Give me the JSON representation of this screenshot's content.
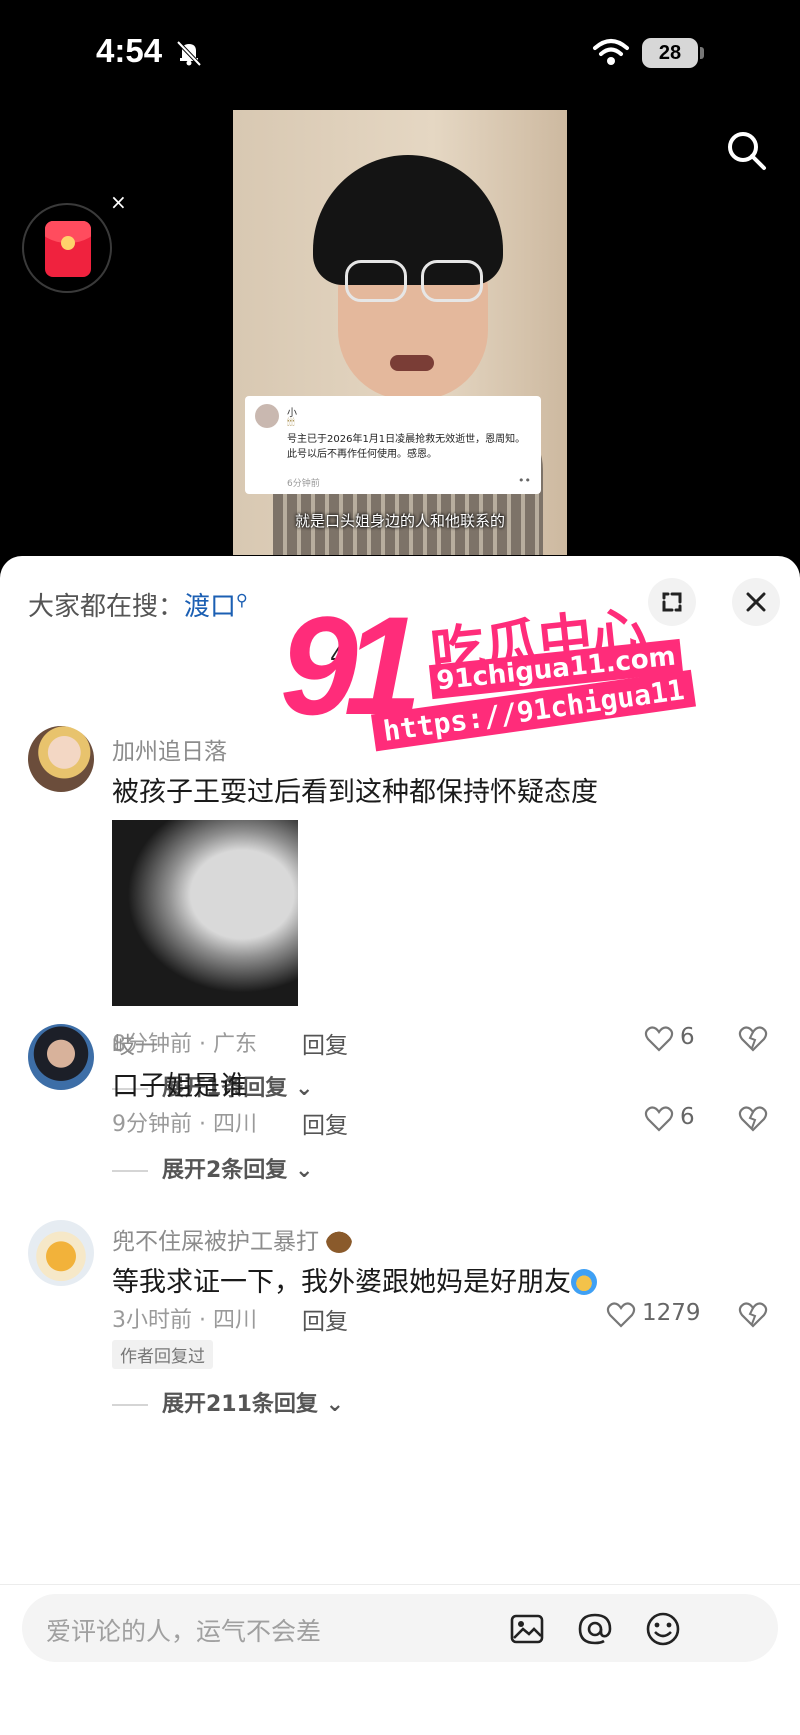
{
  "status_bar": {
    "time": "4:54",
    "battery": "28"
  },
  "video": {
    "card": {
      "name": "小",
      "candles": "🕯🕯🕯",
      "text": "号主已于2026年1月1日凌晨抢救无效逝世，恩周知。此号以后不再作任何使用。感恩。",
      "time": "6分钟前",
      "more": "••"
    },
    "subtitle": "就是口头姐身边的人和他联系的"
  },
  "redpacket_close": "×",
  "sheet": {
    "hot_search_prefix": "大家都在搜：",
    "hot_search_keyword": "渡口",
    "comment_count": "4"
  },
  "watermark": {
    "number": "91",
    "title": "吃瓜中心",
    "domain": "91chigua11.com",
    "url": "https://91chigua11"
  },
  "comments": [
    {
      "username": "加州追日落",
      "text": "被孩子王耍过后看到这种都保持怀疑态度",
      "meta": "8分钟前 · 广东",
      "reply_label": "回复",
      "likes": "6",
      "expand": "展开1条回复",
      "has_photo": true
    },
    {
      "username": "岐一",
      "text": "口子姐是谁",
      "meta": "9分钟前 · 四川",
      "reply_label": "回复",
      "likes": "6",
      "expand": "展开2条回复"
    },
    {
      "username": "兜不住屎被护工暴打",
      "text": "等我求证一下，我外婆跟她妈是好朋友",
      "meta": "3小时前 · 四川",
      "reply_label": "回复",
      "likes": "1279",
      "author_tag": "作者回复过",
      "expand": "展开211条回复"
    }
  ],
  "input": {
    "placeholder": "爱评论的人，运气不会差"
  },
  "colors": {
    "accent": "#1b5fb3",
    "watermark": "#ff2c7a",
    "redpacket": "#f0223e"
  }
}
